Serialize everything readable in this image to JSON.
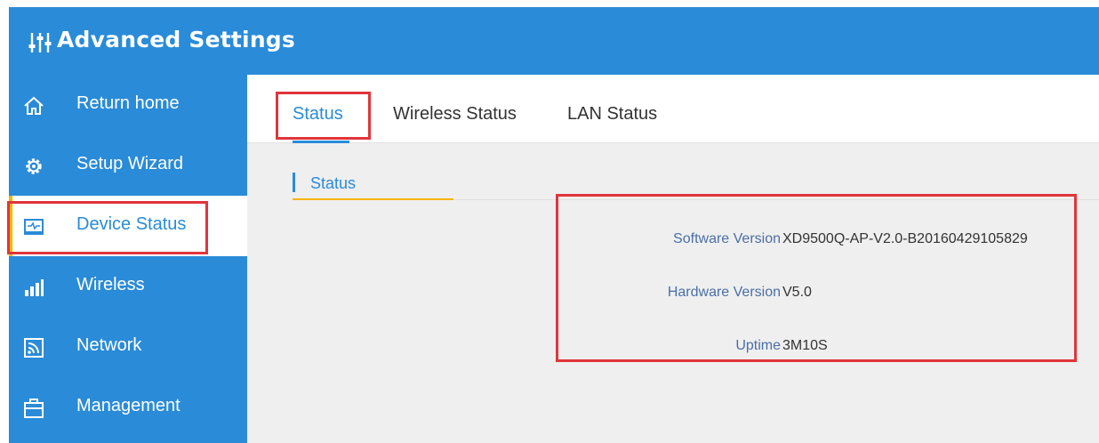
{
  "header": {
    "title": "Advanced Settings",
    "icon": "sliders-icon"
  },
  "sidebar": {
    "items": [
      {
        "label": "Return home",
        "icon": "home-icon"
      },
      {
        "label": "Setup Wizard",
        "icon": "gear-icon"
      },
      {
        "label": "Device Status",
        "icon": "monitor-pulse-icon",
        "active": true
      },
      {
        "label": "Wireless",
        "icon": "signal-bars-icon"
      },
      {
        "label": "Network",
        "icon": "rss-icon"
      },
      {
        "label": "Management",
        "icon": "briefcase-icon"
      }
    ]
  },
  "tabs": [
    {
      "label": "Status",
      "active": true
    },
    {
      "label": "Wireless Status"
    },
    {
      "label": "LAN Status"
    }
  ],
  "section": {
    "title": "Status"
  },
  "info": [
    {
      "label": "Software Version",
      "value": "XD9500Q-AP-V2.0-B20160429105829"
    },
    {
      "label": "Hardware Version",
      "value": "V5.0"
    },
    {
      "label": "Uptime",
      "value": "3M10S"
    }
  ],
  "colors": {
    "brand": "#2a8bd8",
    "accent": "#f7b500",
    "highlight": "#e0353b",
    "label": "#4a6fa5"
  }
}
